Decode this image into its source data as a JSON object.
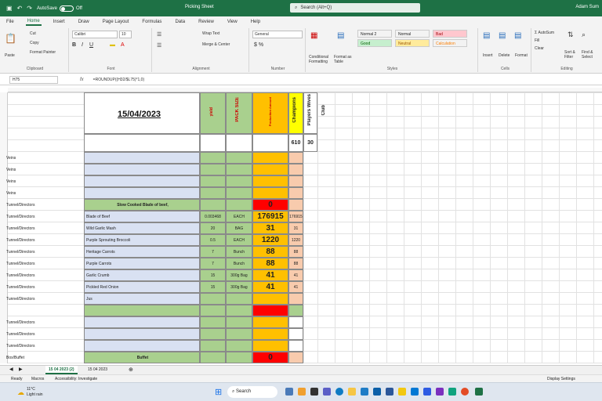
{
  "titlebar": {
    "autosave_label": "AutoSave",
    "autosave_state": "Off",
    "document_title": "Picking Sheet",
    "search_placeholder": "Search (Alt+Q)",
    "user_name": "Adam Sum"
  },
  "menu": [
    "File",
    "Home",
    "Insert",
    "Draw",
    "Page Layout",
    "Formulas",
    "Data",
    "Review",
    "View",
    "Help"
  ],
  "ribbon": {
    "clipboard": {
      "label": "Clipboard",
      "paste": "Paste",
      "cut": "Cut",
      "copy": "Copy",
      "format_painter": "Format Painter"
    },
    "font": {
      "label": "Font",
      "family": "Calibri",
      "size": "10"
    },
    "alignment": {
      "label": "Alignment",
      "wrap_text": "Wrap Text",
      "merge_center": "Merge & Center"
    },
    "number": {
      "label": "Number",
      "format": "General"
    },
    "styles": {
      "label": "Styles",
      "conditional_formatting": "Conditional Formatting",
      "format_as_table": "Format as Table",
      "cells": [
        {
          "name": "Normal 2",
          "color": "#ffffff"
        },
        {
          "name": "Normal",
          "color": "#ffffff"
        },
        {
          "name": "Bad",
          "color": "#ffc7ce"
        },
        {
          "name": "Good",
          "color": "#c6efce"
        },
        {
          "name": "Neutral",
          "color": "#ffeb9c"
        },
        {
          "name": "Calculation",
          "color": "#f2f2f2"
        }
      ]
    },
    "cells": {
      "label": "Cells",
      "insert": "Insert",
      "delete": "Delete",
      "format": "Format"
    },
    "editing": {
      "label": "Editing",
      "autosum": "AutoSum",
      "fill": "Fill",
      "clear": "Clear",
      "sort_filter": "Sort & Filter",
      "find_select": "Find & Select"
    }
  },
  "formula_bar": {
    "name_box": "H75",
    "fx": "fx",
    "formula": "=ROUNDUP((H32/$L75)*1,0)"
  },
  "sheet": {
    "date": "15/04/2023",
    "headers": {
      "yield": "yield",
      "pack_size": "PACK SIZE",
      "production": "Production Amount",
      "champions": "Champions",
      "players_wives": "Players Wives",
      "club": "Club"
    },
    "champions_count": "610",
    "players_wives_count": "30",
    "rows": [
      {
        "label": "Veins",
        "desc": "",
        "yield": "",
        "pack": "",
        "amount": "",
        "champ": ""
      },
      {
        "label": "Veins",
        "desc": "",
        "yield": "",
        "pack": "",
        "amount": "",
        "champ": ""
      },
      {
        "label": "Veins",
        "desc": "",
        "yield": "",
        "pack": "",
        "amount": "",
        "champ": ""
      },
      {
        "label": "Veins",
        "desc": "",
        "yield": "",
        "pack": "",
        "amount": "",
        "champ": ""
      },
      {
        "label": "Tunnel/Directors",
        "desc": "Slow Cooked Blade of beef,",
        "yield": "",
        "pack": "",
        "amount": "0",
        "champ": ""
      },
      {
        "label": "Tunnel/Directors",
        "desc": "Blade of Beef",
        "yield": "0.003468",
        "pack": "EACH",
        "amount": "176915",
        "champ": "176915"
      },
      {
        "label": "Tunnel/Directors",
        "desc": "Wild Garlic Mash",
        "yield": "20",
        "pack": "BAG",
        "amount": "31",
        "champ": "31"
      },
      {
        "label": "Tunnel/Directors",
        "desc": "Purple Sprouting Broccoli",
        "yield": "0.5",
        "pack": "EACH",
        "amount": "1220",
        "champ": "1220"
      },
      {
        "label": "Tunnel/Directors",
        "desc": "Heritage Carrots",
        "yield": "7",
        "pack": "Bunch",
        "amount": "88",
        "champ": "88"
      },
      {
        "label": "Tunnel/Directors",
        "desc": "Purple Carrots",
        "yield": "7",
        "pack": "Bunch",
        "amount": "88",
        "champ": "88"
      },
      {
        "label": "Tunnel/Directors",
        "desc": "Garlic Crumb",
        "yield": "15",
        "pack": "300g Bag",
        "amount": "41",
        "champ": "41"
      },
      {
        "label": "Tunnel/Directors",
        "desc": "Pickled Red Onion",
        "yield": "15",
        "pack": "300g Bag",
        "amount": "41",
        "champ": "41"
      },
      {
        "label": "Tunnel/Directors",
        "desc": "Jus",
        "yield": "",
        "pack": "",
        "amount": "",
        "champ": ""
      },
      {
        "label": "",
        "desc": "",
        "yield": "",
        "pack": "",
        "amount": "",
        "champ": ""
      },
      {
        "label": "Tunnel/Directors",
        "desc": "",
        "yield": "",
        "pack": "",
        "amount": "",
        "champ": ""
      },
      {
        "label": "Tunnel/Directors",
        "desc": "",
        "yield": "",
        "pack": "",
        "amount": "",
        "champ": ""
      },
      {
        "label": "Tunnel/Directors",
        "desc": "",
        "yield": "",
        "pack": "",
        "amount": "",
        "champ": ""
      },
      {
        "label": "Box/Buffet",
        "desc": "Buffet",
        "yield": "",
        "pack": "",
        "amount": "0",
        "champ": ""
      }
    ]
  },
  "tabs": [
    "15 04 2023 (2)",
    "15 04 2023"
  ],
  "status": {
    "ready": "Ready",
    "macro": "Macros",
    "accessibility": "Accessibility: Investigate",
    "display": "Display Settings"
  },
  "taskbar": {
    "weather_temp": "11°C",
    "weather_desc": "Light rain",
    "search": "Search"
  }
}
